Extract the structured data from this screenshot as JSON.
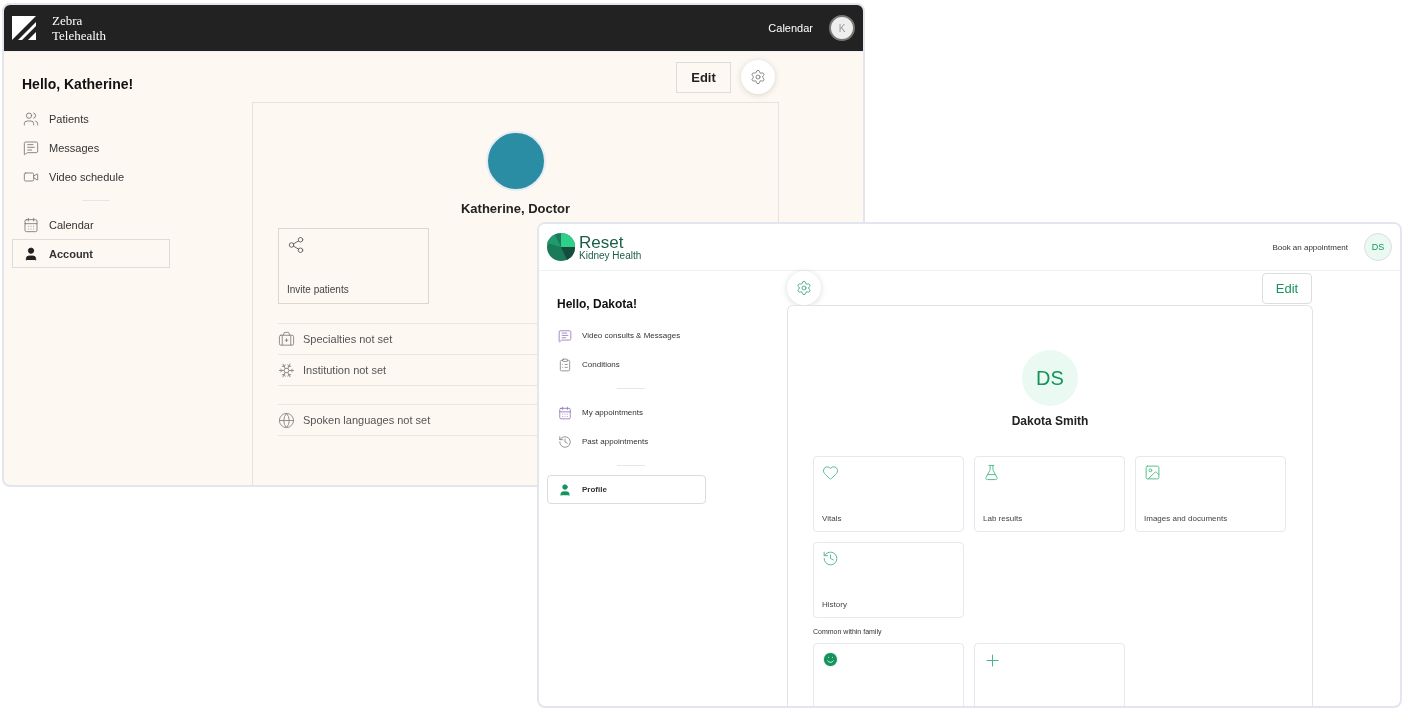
{
  "doctor_window": {
    "brand": "Zebra Telehealth",
    "header_link": "Calendar",
    "avatar_initial": "K",
    "greeting": "Hello, Katherine!",
    "nav_groups": [
      {
        "items": [
          {
            "label": "Patients",
            "selected": false
          },
          {
            "label": "Messages",
            "selected": false
          },
          {
            "label": "Video schedule",
            "selected": false
          }
        ]
      },
      {
        "items": [
          {
            "label": "Calendar",
            "selected": false
          },
          {
            "label": "Account",
            "selected": true
          }
        ]
      }
    ],
    "edit_button": "Edit",
    "profile_name": "Katherine, Doctor",
    "invite_tile": "Invite patients",
    "detail_groups": [
      {
        "items": [
          {
            "label": "Specialties not set"
          },
          {
            "label": "Institution not set"
          }
        ]
      },
      {
        "items": [
          {
            "label": "Spoken languages not set"
          }
        ]
      }
    ]
  },
  "patient_window": {
    "brand": {
      "name": "Reset",
      "tagline": "Kidney Health"
    },
    "header_link": "Book an appointment",
    "avatar_initials": "DS",
    "greeting": "Hello, Dakota!",
    "nav_groups": [
      {
        "items": [
          {
            "label": "Video consults & Messages",
            "selected": false
          },
          {
            "label": "Conditions",
            "selected": false
          }
        ]
      },
      {
        "items": [
          {
            "label": "My appointments",
            "selected": false
          },
          {
            "label": "Past appointments",
            "selected": false
          }
        ]
      },
      {
        "items": [
          {
            "label": "Profile",
            "selected": true
          }
        ]
      }
    ],
    "edit_button": "Edit",
    "profile_initials": "DS",
    "profile_name": "Dakota Smith",
    "tiles": [
      {
        "label": "Vitals"
      },
      {
        "label": "Lab results"
      },
      {
        "label": "Images and documents"
      },
      {
        "label": "History"
      }
    ],
    "family_section": {
      "title": "Common within family"
    }
  }
}
